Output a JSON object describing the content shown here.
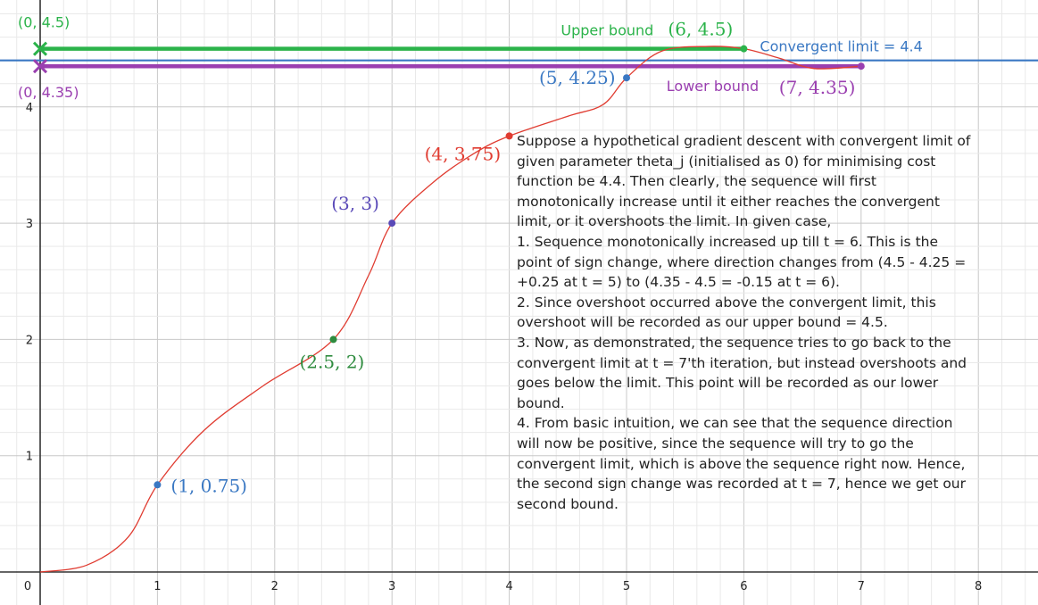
{
  "chart_data": {
    "type": "line",
    "xlim": [
      -0.35,
      8.5
    ],
    "ylim": [
      -0.15,
      4.95
    ],
    "x_ticks": [
      0,
      1,
      2,
      3,
      4,
      5,
      6,
      7,
      8
    ],
    "y_ticks": [
      1,
      2,
      3,
      4
    ],
    "grid": true,
    "curve": {
      "color": "#e03c31",
      "points": [
        [
          0,
          0
        ],
        [
          0.4,
          0.06
        ],
        [
          0.75,
          0.3
        ],
        [
          1,
          0.75
        ],
        [
          1.4,
          1.22
        ],
        [
          1.9,
          1.6
        ],
        [
          2.5,
          2
        ],
        [
          2.8,
          2.55
        ],
        [
          3,
          3
        ],
        [
          3.35,
          3.35
        ],
        [
          3.7,
          3.6
        ],
        [
          4,
          3.75
        ],
        [
          4.5,
          3.92
        ],
        [
          4.8,
          4.02
        ],
        [
          5,
          4.25
        ],
        [
          5.3,
          4.48
        ],
        [
          5.7,
          4.52
        ],
        [
          6,
          4.5
        ],
        [
          6.3,
          4.42
        ],
        [
          6.6,
          4.33
        ],
        [
          7,
          4.35
        ]
      ]
    },
    "points": [
      {
        "x": 0,
        "y": 4.5,
        "label": "(0, 4.5)",
        "color": "#2bb34a",
        "marker": "x"
      },
      {
        "x": 0,
        "y": 4.35,
        "label": "(0, 4.35)",
        "color": "#9a3fb0",
        "marker": "x"
      },
      {
        "x": 1,
        "y": 0.75,
        "label": "(1, 0.75)",
        "color": "#3a78c3"
      },
      {
        "x": 2.5,
        "y": 2,
        "label": "(2.5, 2)",
        "color": "#2e8b3e"
      },
      {
        "x": 3,
        "y": 3,
        "label": "(3, 3)",
        "color": "#5a4ab8"
      },
      {
        "x": 4,
        "y": 3.75,
        "label": "(4, 3.75)",
        "color": "#e03c31"
      },
      {
        "x": 5,
        "y": 4.25,
        "label": "(5, 4.25)",
        "color": "#3a78c3"
      },
      {
        "x": 6,
        "y": 4.5,
        "label": "(6, 4.5)",
        "color": "#2bb34a"
      },
      {
        "x": 7,
        "y": 4.35,
        "label": "(7, 4.35)",
        "color": "#9a3fb0"
      }
    ],
    "lines": [
      {
        "name": "Upper bound",
        "x": [
          0,
          6
        ],
        "y": 4.5,
        "color": "#2bb34a"
      },
      {
        "name": "Lower bound",
        "x": [
          0,
          7
        ],
        "y": 4.35,
        "color": "#9a3fb0"
      },
      {
        "name": "Convergent limit",
        "y": 4.4,
        "color": "#3a78c3",
        "full": true
      }
    ],
    "annotations": {
      "upper": "Upper bound",
      "lower": "Lower bound",
      "limit": "Convergent limit = 4.4"
    }
  },
  "explanation": [
    "Suppose a hypothetical gradient descent with convergent limit of",
    "given parameter theta_j (initialised as 0) for minimising cost",
    "function be 4.4. Then clearly, the sequence will first",
    "monotonically increase until it either reaches the convergent",
    "limit, or it overshoots the limit. In given case,",
    "1. Sequence monotonically increased up till t = 6. This is the",
    "point of sign change, where direction changes from (4.5 - 4.25 =",
    "+0.25 at t = 5) to (4.35 - 4.5 = -0.15 at t = 6).",
    "2. Since overshoot occurred above the convergent limit, this",
    "overshoot will be recorded as our upper bound = 4.5.",
    "3. Now, as demonstrated, the sequence tries to go back to the",
    "convergent limit at t = 7'th iteration, but instead overshoots and",
    "goes below the limit. This point will be recorded as our lower",
    "bound.",
    "4. From basic intuition, we can see that the sequence direction",
    "will now be positive, since the sequence will try to go the",
    "convergent limit, which is above the sequence right now. Hence,",
    "the second sign change was recorded at t = 7, hence we get our",
    "second bound."
  ]
}
